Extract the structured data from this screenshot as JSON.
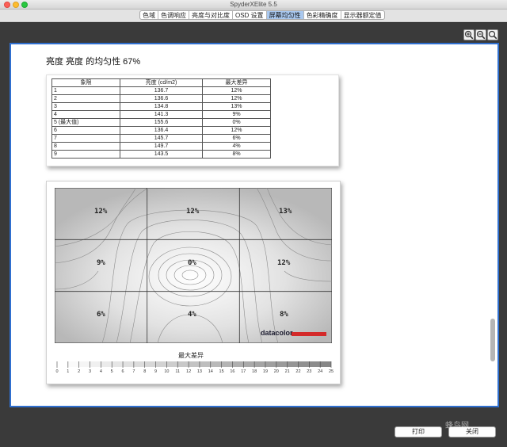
{
  "window": {
    "title": "SpyderXElite 5.5"
  },
  "tabs": [
    {
      "label": "色域",
      "active": false
    },
    {
      "label": "色调响应",
      "active": false
    },
    {
      "label": "亮度与对比度",
      "active": false
    },
    {
      "label": "OSD 设置",
      "active": false
    },
    {
      "label": "屏幕均匀性",
      "active": true
    },
    {
      "label": "色彩精确度",
      "active": false
    },
    {
      "label": "显示器额定值",
      "active": false
    }
  ],
  "zoom": {
    "icons": [
      "zoom-in-icon",
      "zoom-out-icon",
      "zoom-reset-icon"
    ]
  },
  "report": {
    "title": "亮度 亮度 的均匀性 67%",
    "table": {
      "headers": [
        "象限",
        "亮度 (cd/m2)",
        "最大差异"
      ],
      "rows": [
        [
          "1",
          "136.7",
          "12%"
        ],
        [
          "2",
          "136.6",
          "12%"
        ],
        [
          "3",
          "134.8",
          "13%"
        ],
        [
          "4",
          "141.3",
          "9%"
        ],
        [
          "5 (最大值)",
          "155.6",
          "0%"
        ],
        [
          "6",
          "136.4",
          "12%"
        ],
        [
          "7",
          "145.7",
          "6%"
        ],
        [
          "8",
          "149.7",
          "4%"
        ],
        [
          "9",
          "143.5",
          "8%"
        ]
      ]
    },
    "map": {
      "cells": [
        "12%",
        "12%",
        "13%",
        "9%",
        "0%",
        "12%",
        "6%",
        "4%",
        "8%"
      ],
      "logo": "datacolor",
      "legend_title": "最大差异",
      "legend_ticks": [
        "0",
        "1",
        "2",
        "3",
        "4",
        "5",
        "6",
        "7",
        "8",
        "9",
        "10",
        "11",
        "12",
        "13",
        "14",
        "15",
        "16",
        "17",
        "18",
        "19",
        "20",
        "21",
        "22",
        "23",
        "24",
        "25"
      ]
    }
  },
  "buttons": {
    "print": "打印",
    "close": "关闭"
  },
  "watermark": "蜂鸟网",
  "colors": {
    "active_tab": "#a9c8ef",
    "frame_border": "#2f6fcf",
    "logo_bar": "#d42a2a"
  }
}
